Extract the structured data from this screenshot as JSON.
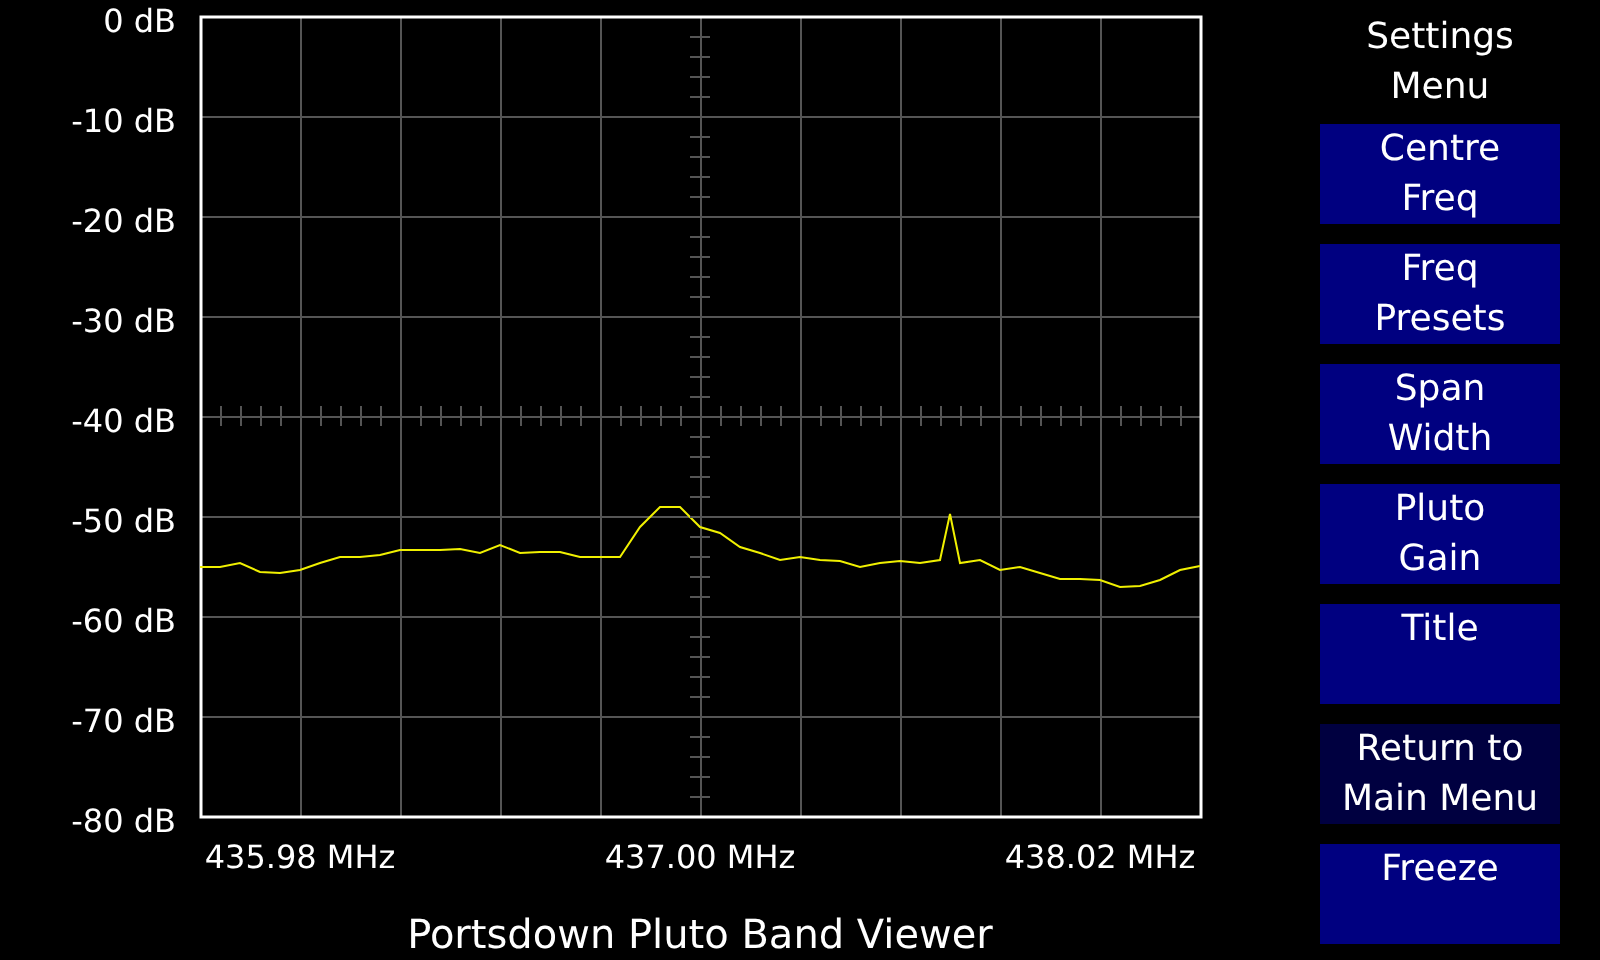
{
  "chart_data": {
    "type": "line",
    "xlim": [
      435.725,
      438.275
    ],
    "ylim": [
      -80,
      0
    ],
    "grid": true,
    "xticks": [
      {
        "value": 435.98,
        "label": "435.98 MHz"
      },
      {
        "value": 437.0,
        "label": "437.00 MHz"
      },
      {
        "value": 438.02,
        "label": "438.02 MHz"
      }
    ],
    "yticks": [
      {
        "value": 0,
        "label": "0 dB"
      },
      {
        "value": -10,
        "label": "-10 dB"
      },
      {
        "value": -20,
        "label": "-20 dB"
      },
      {
        "value": -30,
        "label": "-30 dB"
      },
      {
        "value": -40,
        "label": "-40 dB"
      },
      {
        "value": -50,
        "label": "-50 dB"
      },
      {
        "value": -60,
        "label": "-60 dB"
      },
      {
        "value": -70,
        "label": "-70 dB"
      },
      {
        "value": -80,
        "label": "-80 dB"
      }
    ],
    "x": [
      435.725,
      435.776,
      435.827,
      435.878,
      435.929,
      435.98,
      436.031,
      436.082,
      436.133,
      436.184,
      436.235,
      436.286,
      436.337,
      436.388,
      436.439,
      436.49,
      436.541,
      436.592,
      436.643,
      436.694,
      436.745,
      436.796,
      436.847,
      436.898,
      436.949,
      437.0,
      437.051,
      437.102,
      437.153,
      437.204,
      437.255,
      437.306,
      437.357,
      437.408,
      437.459,
      437.51,
      437.561,
      437.612,
      437.6375,
      437.663,
      437.714,
      437.765,
      437.816,
      437.867,
      437.918,
      437.969,
      438.02,
      438.071,
      438.122,
      438.173,
      438.224,
      438.275
    ],
    "series": [
      {
        "color": "#f0f000",
        "values": [
          -55.1,
          -55.1,
          -54.7,
          -55.6,
          -55.7,
          -55.4,
          -54.7,
          -54.1,
          -54.1,
          -53.9,
          -53.4,
          -53.4,
          -53.4,
          -53.3,
          -53.7,
          -52.9,
          -53.7,
          -53.6,
          -53.6,
          -54.1,
          -54.1,
          -54.1,
          -51.1,
          -49.1,
          -49.1,
          -51.1,
          -51.7,
          -53.1,
          -53.7,
          -54.4,
          -54.1,
          -54.4,
          -54.5,
          -55.1,
          -54.7,
          -54.5,
          -54.7,
          -54.4,
          -49.8,
          -54.7,
          -54.4,
          -55.4,
          -55.1,
          -55.7,
          -56.3,
          -56.3,
          -56.4,
          -57.1,
          -57.0,
          -56.4,
          -55.4,
          -55.0
        ]
      }
    ]
  },
  "title": "Portsdown Pluto Band Viewer",
  "menu_title": "Settings\nMenu",
  "buttons": [
    {
      "label": "Centre\nFreq",
      "color": "#000080"
    },
    {
      "label": "Freq\nPresets",
      "color": "#000080"
    },
    {
      "label": "Span\nWidth",
      "color": "#000080"
    },
    {
      "label": "Pluto\nGain",
      "color": "#000080"
    },
    {
      "label": "Title",
      "color": "#000080"
    },
    {
      "label": "Return to\nMain Menu",
      "color": "#000040"
    },
    {
      "label": "Freeze",
      "color": "#000080"
    }
  ]
}
